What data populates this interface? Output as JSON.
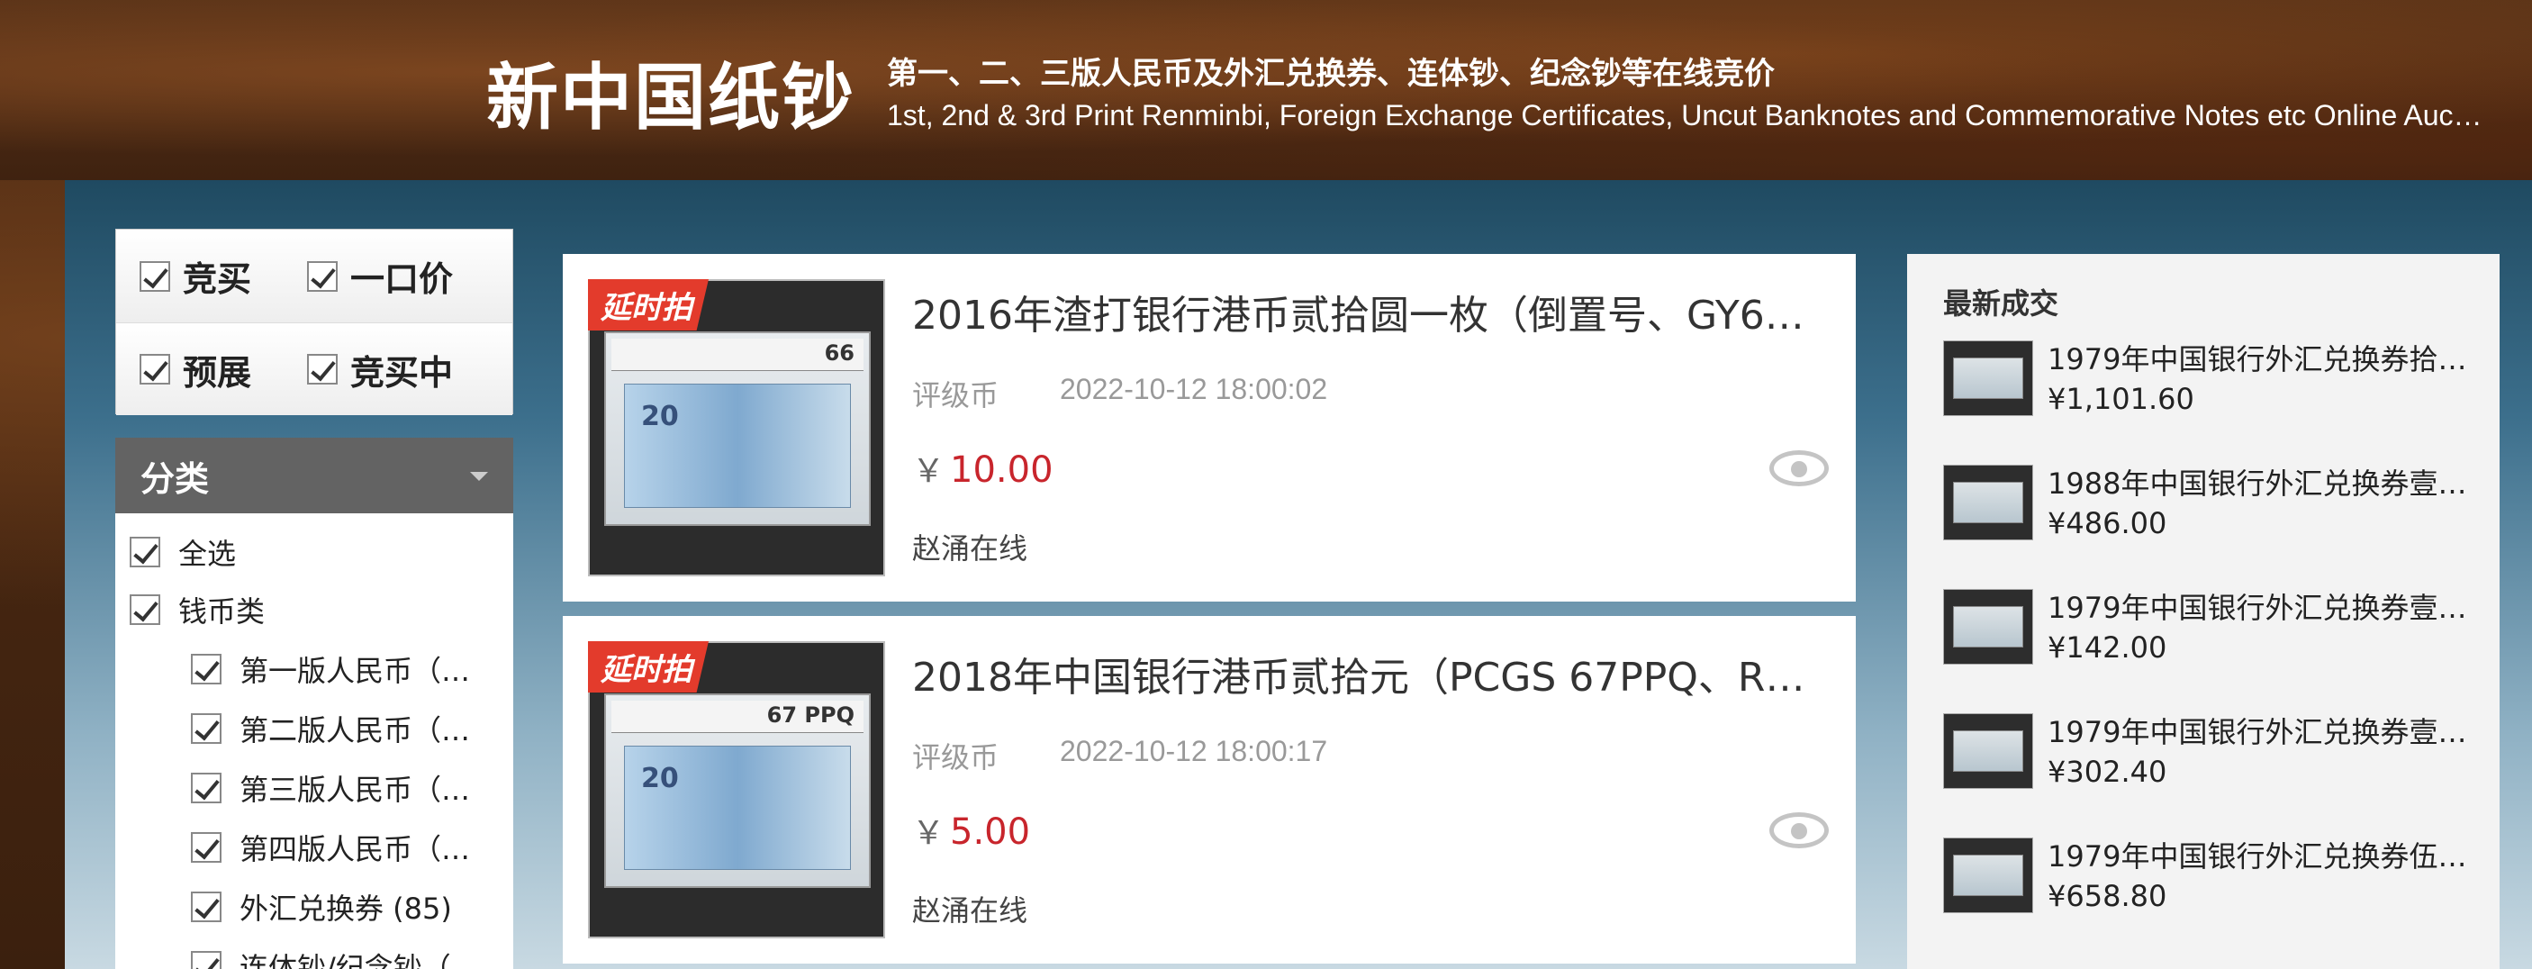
{
  "header": {
    "title": "新中国纸钞",
    "subtitle_cn": "第一、二、三版人民币及外汇兑换券、连体钞、纪念钞等在线竞价",
    "subtitle_en": "1st, 2nd & 3rd Print Renminbi, Foreign Exchange Certificates, Uncut Banknotes and Commemorative Notes etc Online Auction"
  },
  "filters": {
    "row1": [
      {
        "label": "竞买"
      },
      {
        "label": "一口价"
      }
    ],
    "row2": [
      {
        "label": "预展"
      },
      {
        "label": "竞买中"
      }
    ]
  },
  "category": {
    "title": "分类",
    "items": [
      {
        "label": "全选"
      },
      {
        "label": "钱币类"
      },
      {
        "label": "第一版人民币（…"
      },
      {
        "label": "第二版人民币（…"
      },
      {
        "label": "第三版人民币（…"
      },
      {
        "label": "第四版人民币（…"
      },
      {
        "label": "外汇兑换券 (85)"
      },
      {
        "label": "连体钞/纪念钞（…"
      }
    ]
  },
  "lots": [
    {
      "tag": "延时拍",
      "title": "2016年渣打银行港币贰拾圆一枚（倒置号、GY6…",
      "type": "评级币",
      "time": "2022-10-12 18:00:02",
      "currency": "￥",
      "price": "10.00",
      "seller": "赵涌在线",
      "slab_grade": "66",
      "note_value": "20"
    },
    {
      "tag": "延时拍",
      "title": "2018年中国银行港币贰拾元（PCGS 67PPQ、R…",
      "type": "评级币",
      "time": "2022-10-12 18:00:17",
      "currency": "￥",
      "price": "5.00",
      "seller": "赵涌在线",
      "slab_grade": "67 PPQ",
      "note_value": "20"
    }
  ],
  "latest": {
    "title": "最新成交",
    "deals": [
      {
        "name": "1979年中国银行外汇兑换券拾…",
        "price": "¥1,101.60"
      },
      {
        "name": "1988年中国银行外汇兑换券壹…",
        "price": "¥486.00"
      },
      {
        "name": "1979年中国银行外汇兑换券壹…",
        "price": "¥142.00"
      },
      {
        "name": "1979年中国银行外汇兑换券壹…",
        "price": "¥302.40"
      },
      {
        "name": "1979年中国银行外汇兑换券伍…",
        "price": "¥658.80"
      }
    ]
  },
  "colors": {
    "price_red": "#c8252c",
    "tag_red": "#e33b2c",
    "category_header": "#636363"
  }
}
